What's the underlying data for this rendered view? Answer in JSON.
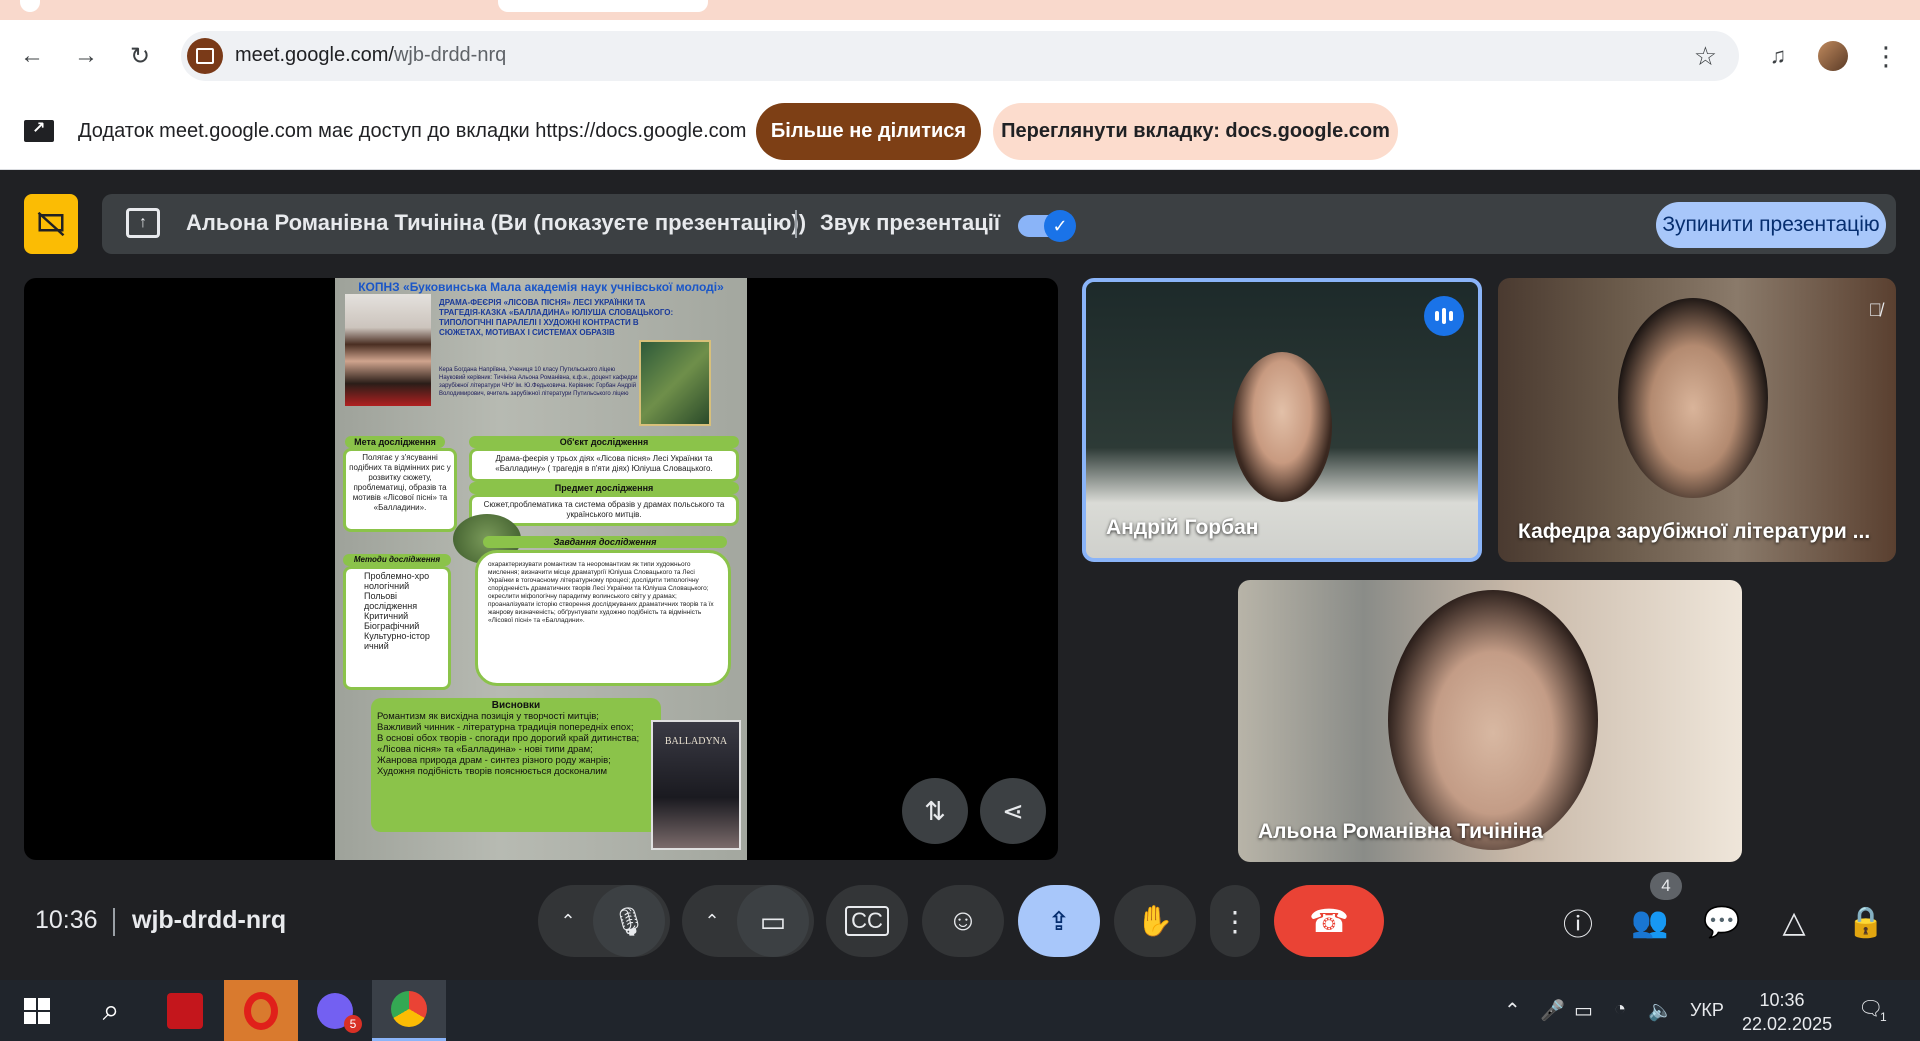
{
  "browser": {
    "url_host": "meet.google.com/",
    "url_path": "wjb-drdd-nrq",
    "back_icon": "arrow-left-icon",
    "forward_icon": "arrow-right-icon",
    "reload_icon": "reload-icon"
  },
  "share_bar": {
    "message": "Додаток meet.google.com має доступ до вкладки https://docs.google.com",
    "stop_sharing_label": "Більше не ділитися",
    "view_tab_label": "Переглянути вкладку: docs.google.com"
  },
  "presentation": {
    "presenter": "Альона Романівна Тичініна (Ви (показуєте презентацію))",
    "sound_label": "Звук презентації",
    "sound_enabled": true,
    "stop_label": "Зупинити презентацію"
  },
  "slide": {
    "title": "КОПНЗ «Буковинська Мала академія наук учнівської молоді»",
    "topic": "ДРАМА-ФЕЄРІЯ «ЛІСОВА ПІСНЯ» ЛЕСІ УКРАЇНКИ ТА ТРАГЕДІЯ-КАЗКА «БАЛЛАДИНА» ЮЛІУША СЛОВАЦЬКОГО: ТИПОЛОГІЧНІ ПАРАЛЕЛІ І ХУДОЖНІ КОНТРАСТИ В СЮЖЕТАХ, МОТИВАХ І СИСТЕМАХ ОБРАЗІВ",
    "meta": "Кера Богдана Напріївна, Учениця 10 класу Путильського ліцею Науковий керівник: Тичініна Альона Романівна, к.ф.н., доцент кафедри зарубіжної літератури ЧНУ ім. Ю.Федьковича. Керівник: Горбан Андрій Володимирович, вчитель зарубіжної літератури Путильського ліцею",
    "goal_head": "Мета дослідження",
    "goal_text": "Полягає у з'ясуванні подібних та відмінних рис у розвитку сюжету, проблематиці, образів та мотивів «Лісової пісні» та «Балладини».",
    "object_head": "Об'єкт дослідження",
    "object_text": "Драма-феєрія у трьох діях «Лісова пісня» Лесі Українки та «Балладину» ( трагедія в п'яти діях) Юліуша Словацького.",
    "subject_head": "Предмет дослідження",
    "subject_text": "Сюжет,проблематика та система образів у драмах польського та українського митців.",
    "methods_head": "Методи дослідження",
    "methods": [
      "Проблемно-хро нологічний",
      "Польові дослідження",
      "Критичний",
      "Біографічний",
      "Культурно-істор ичний"
    ],
    "tasks_head": "Завдання дослідження",
    "tasks": "охарактеризувати романтизм та неоромантизм як типи художнього мислення; визначити місце драматургії Юліуша Словацького та Лесі Українки в тогочасному літературному процесі; дослідити типологічну спорідненість драматичних творів Лесі Українки та Юліуша Словацького; окреслити міфологічну парадигму волинського світу у драмах; проаналізувати історію створення досліджуваних драматичних творів та їх жанрову визначеність; обґрунтувати художню подібність та відмінність «Лісової пісні» та «Балладини».",
    "conclusions_head": "Висновки",
    "conclusions": [
      "Романтизм як висхідна позиція у творчості митців;",
      "Важливий чинник - літературна традиція попередніх епох;",
      "В основі обох творів - спогади про дорогий край дитинства;",
      "«Лісова пісня» та «Балладина» - нові типи драм;",
      "Жанрова природа драм - синтез різного роду жанрів;",
      "Художня подібність творів пояснюється досконалим"
    ],
    "book2_title": "BALLADYNA"
  },
  "participants": [
    {
      "name": "Андрій Горбан",
      "speaking": true
    },
    {
      "name": "Кафедра зарубіжної літератури ...",
      "muted": true
    },
    {
      "name": "Альона Романівна Тичініна"
    }
  ],
  "footer": {
    "time": "10:36",
    "meeting_code": "wjb-drdd-nrq",
    "participant_count": "4"
  },
  "taskbar": {
    "language": "УКР",
    "time": "10:36",
    "date": "22.02.2025",
    "notifications": "1",
    "viber_badge": "5"
  },
  "colors": {
    "meet_bg": "#202124",
    "accent_blue": "#a8c7fa",
    "end_call_red": "#ea4335",
    "share_brown": "#7d3f15"
  }
}
